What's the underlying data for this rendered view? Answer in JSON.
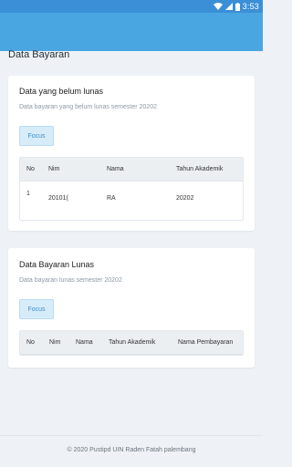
{
  "statusbar": {
    "time": "3:53"
  },
  "page": {
    "title": "Data Bayaran"
  },
  "unpaid": {
    "title": "Data yang belum lunas",
    "subtitle": "Data bayaran yang belum lunas semester 20202",
    "focus_label": "Focus",
    "columns": [
      "No",
      "Nim",
      "Nama",
      "Tahun Akademik"
    ],
    "rows": [
      {
        "no": "1",
        "nim": "20101(",
        "nama": "RA",
        "tahun": "20202"
      }
    ]
  },
  "paid": {
    "title": "Data Bayaran Lunas",
    "subtitle": "Data bayaran lunas semester 20202",
    "focus_label": "Focus",
    "columns": [
      "No",
      "Nim",
      "Nama",
      "Tahun Akademik",
      "Nama Pembayaran"
    ]
  },
  "footer": {
    "text": "© 2020 Pustipd UIN Raden Fatah palembang"
  },
  "colors": {
    "statusbar": "#3a8fd6",
    "appbar": "#4aa6e0",
    "background": "#eef2f6",
    "focus_bg": "#d7ecf9",
    "focus_text": "#3b8fc9"
  }
}
